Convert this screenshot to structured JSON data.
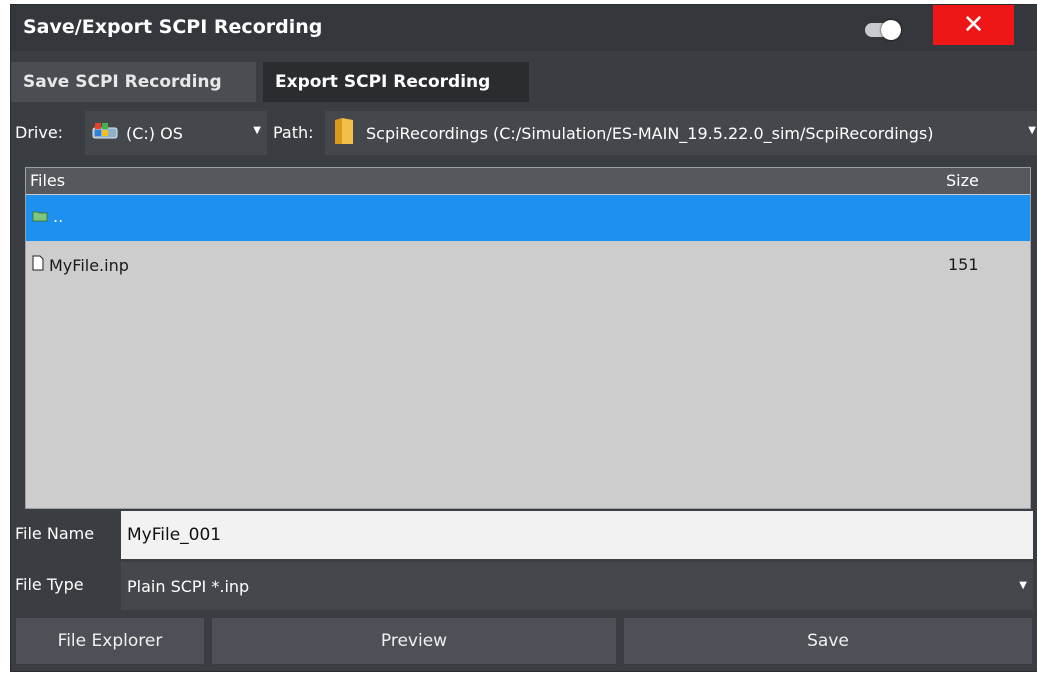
{
  "dialog": {
    "title": "Save/Export SCPI Recording",
    "close_label": "✕"
  },
  "tabs": [
    {
      "label": "Save SCPI Recording",
      "active": false
    },
    {
      "label": "Export SCPI Recording",
      "active": true
    }
  ],
  "drive": {
    "label": "Drive:",
    "value": "(C:) OS",
    "icon": "drive-icon"
  },
  "path": {
    "label": "Path:",
    "value": "ScpiRecordings (C:/Simulation/ES-MAIN_19.5.22.0_sim/ScpiRecordings)",
    "icon": "folder-icon"
  },
  "files": {
    "columns": [
      "Files",
      "Size"
    ],
    "rows": [
      {
        "name": "..",
        "size": "",
        "type": "folder",
        "selected": true
      },
      {
        "name": "MyFile.inp",
        "size": "151",
        "type": "file",
        "selected": false
      }
    ]
  },
  "file_name": {
    "label": "File Name",
    "value": "MyFile_001"
  },
  "file_type": {
    "label": "File Type",
    "value": "Plain SCPI *.inp"
  },
  "buttons": {
    "file_explorer": "File Explorer",
    "preview": "Preview",
    "save": "Save"
  },
  "colors": {
    "accent": "#1e90f0",
    "close": "#ee1616",
    "background": "#3a3d42"
  }
}
